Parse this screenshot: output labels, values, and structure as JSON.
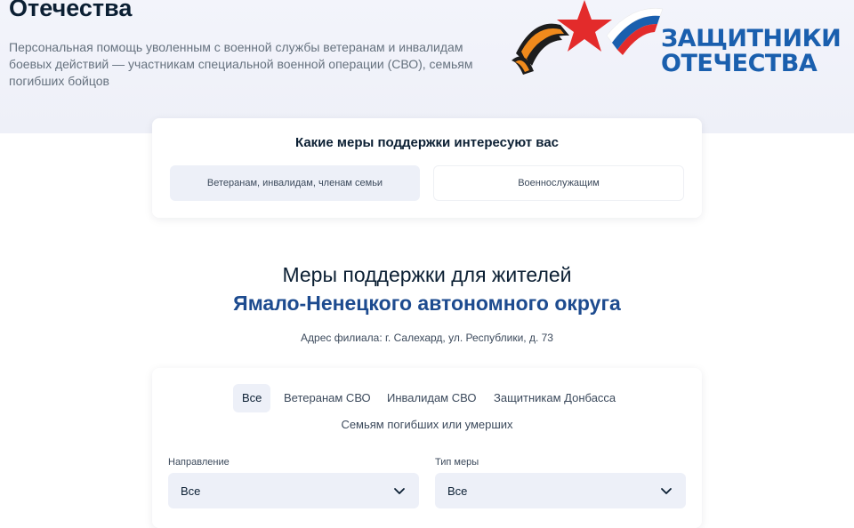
{
  "hero": {
    "title_top": "Защитники Отечества",
    "title": "Отечества",
    "description": "Персональная помощь уволенным с военной службы ветеранам и инвалидам боевых действий — участникам специальной военной операции (СВО), семьям погибших бойцов",
    "logo_line1": "ЗАЩИТНИКИ",
    "logo_line2": "ОТЕЧЕСТВА"
  },
  "question": {
    "title": "Какие меры поддержки интересуют вас",
    "options": [
      "Ветеранам, инвалидам, членам семьи",
      "Военнослужащим"
    ],
    "selected": 0
  },
  "measures": {
    "title": "Меры поддержки для жителей",
    "region": "Ямало-Ненецкого автономного округа",
    "address": "Адрес филиала: г. Салехард, ул. Республики, д. 73"
  },
  "filters": {
    "chips": [
      "Все",
      "Ветеранам СВО",
      "Инвалидам СВО",
      "Защитникам Донбасса"
    ],
    "chip_second_row": "Семьям погибших или умерших",
    "active_chip": 0,
    "direction_label": "Направление",
    "direction_value": "Все",
    "type_label": "Тип меры",
    "type_value": "Все"
  },
  "colors": {
    "accent_blue": "#1d4b8f",
    "logo_blue": "#1a5fae",
    "star_red": "#e32b2b",
    "ribbon_orange": "#f08a1c",
    "chip_bg": "#edf0f8"
  }
}
